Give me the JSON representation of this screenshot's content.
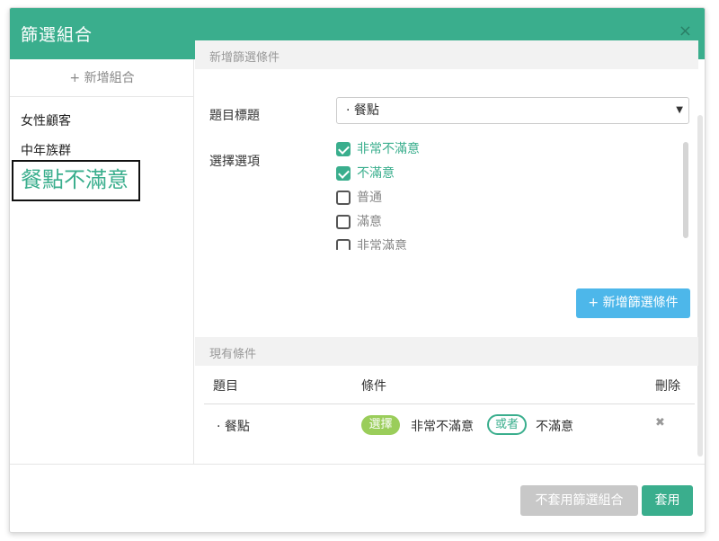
{
  "modal": {
    "title": "篩選組合",
    "close_icon": "×"
  },
  "sidebar": {
    "add_label": "+ 新增組合",
    "items": [
      {
        "label": "女性顧客"
      },
      {
        "label": "中年族群"
      },
      {
        "label": "餐點不滿意",
        "active": true
      }
    ]
  },
  "new_filter": {
    "section_title": "新增篩選條件",
    "question_label": "題目標題",
    "question_value": "· 餐點",
    "options_label": "選擇選項",
    "options": [
      {
        "label": "非常不滿意",
        "checked": true
      },
      {
        "label": "不滿意",
        "checked": true
      },
      {
        "label": "普通",
        "checked": false
      },
      {
        "label": "滿意",
        "checked": false
      },
      {
        "label": "非常滿意",
        "checked": false
      }
    ],
    "add_button": "+ 新增篩選條件"
  },
  "existing": {
    "section_title": "現有條件",
    "columns": {
      "question": "題目",
      "condition": "條件",
      "delete": "刪除"
    },
    "rows": [
      {
        "question": "· 餐點",
        "badge": "選擇",
        "value1": "非常不滿意",
        "joiner": "或者",
        "value2": "不滿意",
        "delete_icon": "✖"
      }
    ]
  },
  "footer": {
    "no_apply_label": "不套用篩選組合",
    "apply_label": "套用"
  },
  "colors": {
    "primary": "#3aae8d",
    "info": "#4db7ea",
    "badge": "#9acd5a",
    "disabled": "#c8c8c8"
  }
}
